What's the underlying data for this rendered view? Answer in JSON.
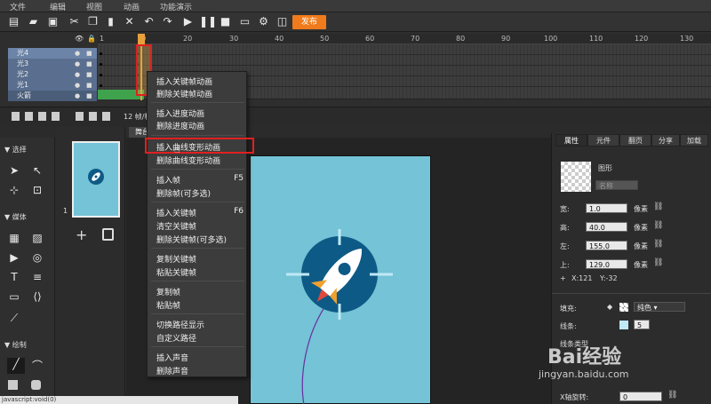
{
  "menu": [
    "文件",
    "编辑",
    "视图",
    "动画",
    "功能演示"
  ],
  "toolbar": {
    "publish_label": "发布",
    "icons": [
      "menu-icon",
      "open-icon",
      "save-icon",
      "cut-icon",
      "copy-icon",
      "paste-icon",
      "delete-icon",
      "undo-icon",
      "redo-icon",
      "play-icon",
      "pause-icon",
      "preview-icon",
      "screen-icon",
      "settings-icon",
      "image-icon"
    ]
  },
  "timeline": {
    "ticks": [
      "1",
      "10",
      "20",
      "30",
      "40",
      "50",
      "60",
      "70",
      "80",
      "90",
      "100",
      "110",
      "120",
      "130"
    ],
    "layers": [
      "光4",
      "光3",
      "光2",
      "光1",
      "火箭"
    ],
    "fps_label": "12 帧/秒"
  },
  "tools": {
    "sections": [
      "选择",
      "媒体",
      "绘制"
    ]
  },
  "pages": {
    "page_number": "1"
  },
  "stage": {
    "tab_label": "舞台"
  },
  "right_panel": {
    "tabs": [
      "属性",
      "元件",
      "翻页",
      "分享",
      "加载"
    ],
    "shape_type": "图形",
    "name_placeholder": "名称",
    "fields": [
      {
        "label": "宽:",
        "value": "1.0",
        "unit": "像素"
      },
      {
        "label": "高:",
        "value": "40.0",
        "unit": "像素"
      },
      {
        "label": "左:",
        "value": "155.0",
        "unit": "像素"
      },
      {
        "label": "上:",
        "value": "129.0",
        "unit": "像素"
      }
    ],
    "coord_x": "X:121",
    "coord_y": "Y:-32",
    "fill_label": "填充:",
    "fill_value": "纯色",
    "stroke_label": "线条:",
    "stroke_value": "5",
    "stroke_type_label": "线条类型",
    "x_rotate_label": "X轴旋转:",
    "x_rotate_value": "0"
  },
  "context_menu": {
    "items": [
      {
        "label": "插入关键帧动画",
        "shortcut": ""
      },
      {
        "label": "删除关键帧动画",
        "shortcut": ""
      },
      {
        "label": "插入进度动画",
        "shortcut": ""
      },
      {
        "label": "删除进度动画",
        "shortcut": ""
      },
      {
        "label": "插入曲线变形动画",
        "shortcut": ""
      },
      {
        "label": "删除曲线变形动画",
        "shortcut": ""
      },
      {
        "label": "插入帧",
        "shortcut": "F5"
      },
      {
        "label": "删除帧(可多选)",
        "shortcut": ""
      },
      {
        "label": "插入关键帧",
        "shortcut": "F6"
      },
      {
        "label": "清空关键帧",
        "shortcut": ""
      },
      {
        "label": "删除关键帧(可多选)",
        "shortcut": ""
      },
      {
        "label": "复制关键帧",
        "shortcut": ""
      },
      {
        "label": "粘贴关键帧",
        "shortcut": ""
      },
      {
        "label": "复制帧",
        "shortcut": ""
      },
      {
        "label": "粘贴帧",
        "shortcut": ""
      },
      {
        "label": "切换路径显示",
        "shortcut": ""
      },
      {
        "label": "自定义路径",
        "shortcut": ""
      },
      {
        "label": "插入声音",
        "shortcut": ""
      },
      {
        "label": "删除声音",
        "shortcut": ""
      }
    ]
  },
  "status": "javascript:void(0)",
  "watermark": {
    "main": "Bai经验",
    "sub": "jingyan.baidu.com"
  },
  "colors": {
    "accent": "#f07b1c",
    "highlight": "#e02020",
    "stage": "#74c3d6",
    "rocket_badge": "#0e5a86"
  }
}
